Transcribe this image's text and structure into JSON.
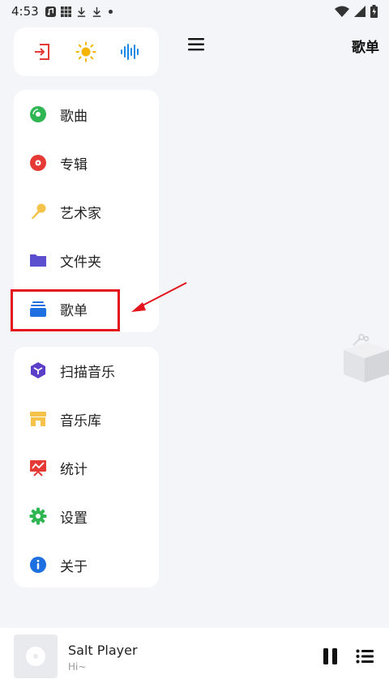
{
  "status_bar": {
    "time": "4:53",
    "icons": [
      "music-note-icon",
      "grid-icon",
      "download-icon",
      "download-icon",
      "dot-icon"
    ],
    "right_icons": [
      "wifi-icon",
      "signal-icon",
      "battery-icon"
    ]
  },
  "header": {
    "title": "歌单",
    "menu_icon": "menu-icon"
  },
  "drawer": {
    "top_actions": [
      {
        "icon": "exit-icon",
        "color": "#e53935"
      },
      {
        "icon": "sun-icon",
        "color": "#f5b400"
      },
      {
        "icon": "waveform-icon",
        "color": "#1e88e5"
      }
    ],
    "library": [
      {
        "label": "歌曲",
        "icon": "song-disc-icon",
        "color": "#2fb551"
      },
      {
        "label": "专辑",
        "icon": "album-disc-icon",
        "color": "#e53935"
      },
      {
        "label": "艺术家",
        "icon": "microphone-icon",
        "color": "#f5c24a"
      },
      {
        "label": "文件夹",
        "icon": "folder-icon",
        "color": "#5b4fcf"
      },
      {
        "label": "歌单",
        "icon": "playlist-stack-icon",
        "color": "#1e6fe0"
      }
    ],
    "tools": [
      {
        "label": "扫描音乐",
        "icon": "scan-cube-icon",
        "color": "#5b3fc9"
      },
      {
        "label": "音乐库",
        "icon": "store-icon",
        "color": "#f5c24a"
      },
      {
        "label": "统计",
        "icon": "stats-board-icon",
        "color": "#e53935"
      },
      {
        "label": "设置",
        "icon": "gear-icon",
        "color": "#2fb551"
      },
      {
        "label": "关于",
        "icon": "info-icon",
        "color": "#1e6fe0"
      }
    ]
  },
  "annotation": {
    "highlight_color": "#e3141b"
  },
  "player": {
    "title": "Salt Player",
    "subtitle": "Hi~"
  }
}
